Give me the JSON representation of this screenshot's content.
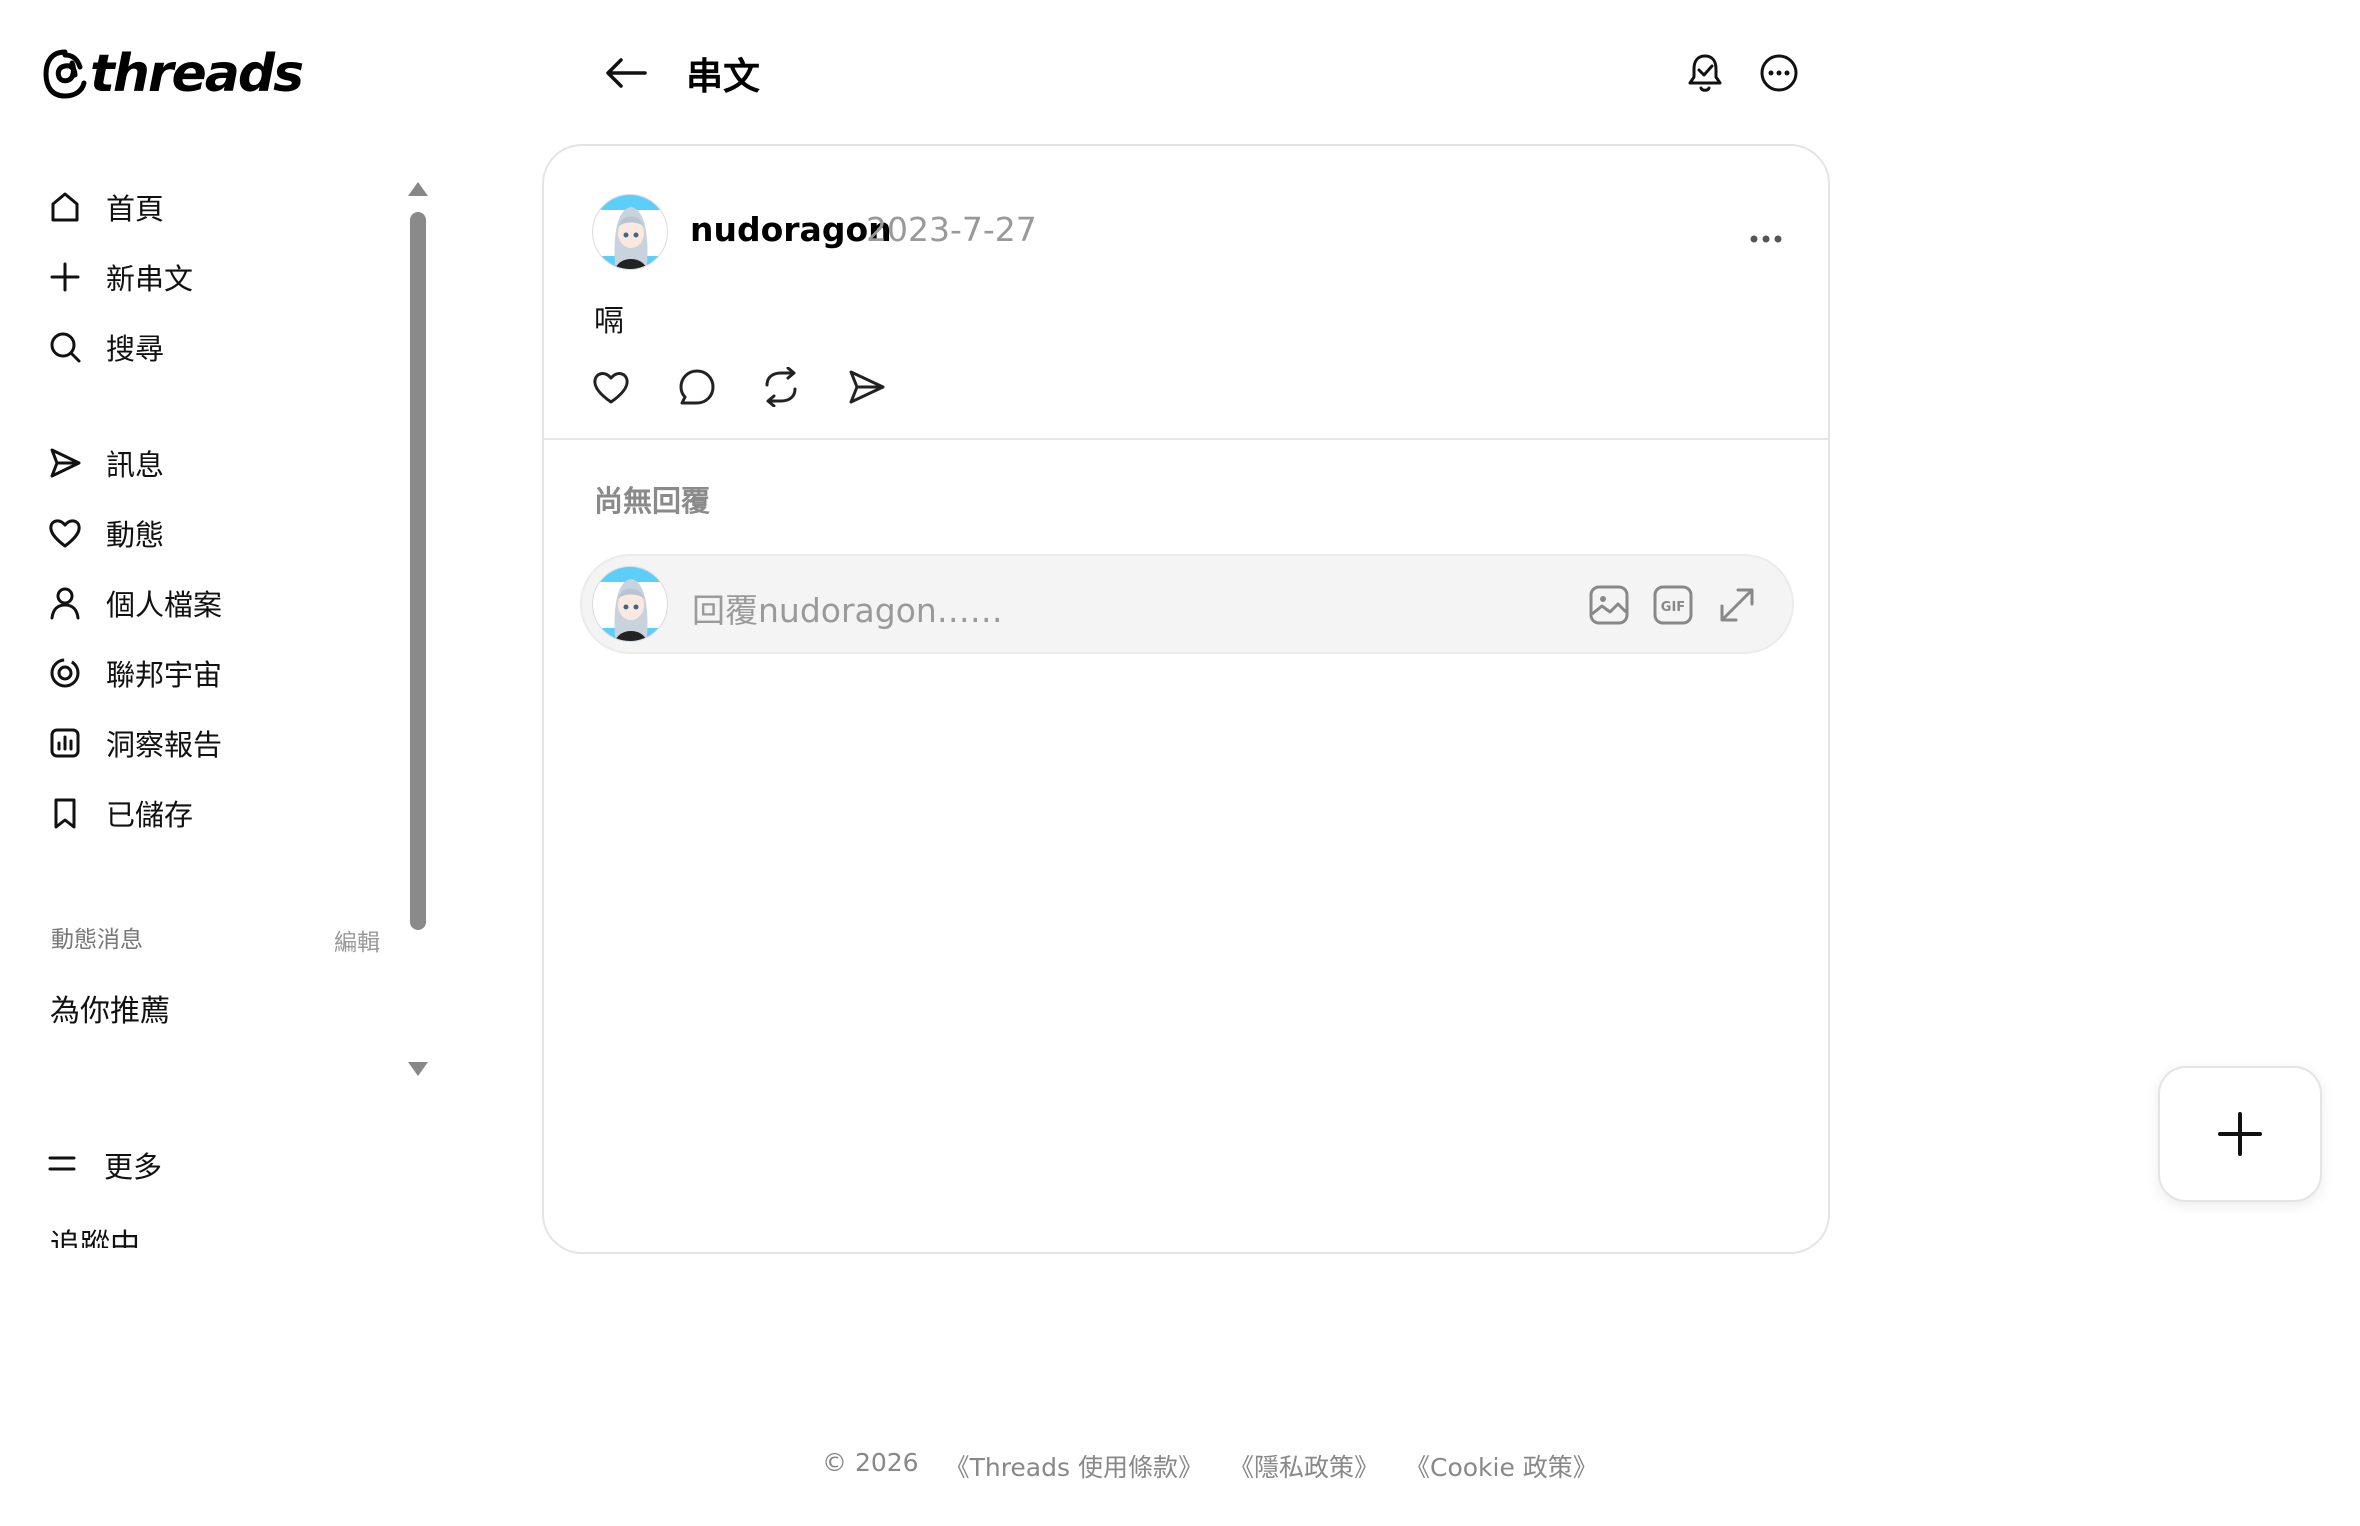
{
  "app": {
    "logo_text": "threads"
  },
  "sidebar": {
    "items": [
      {
        "label": "首頁",
        "icon": "home-icon"
      },
      {
        "label": "新串文",
        "icon": "plus-icon"
      },
      {
        "label": "搜尋",
        "icon": "search-icon"
      },
      {
        "label": "訊息",
        "icon": "send-icon"
      },
      {
        "label": "動態",
        "icon": "heart-icon"
      },
      {
        "label": "個人檔案",
        "icon": "person-icon"
      },
      {
        "label": "聯邦宇宙",
        "icon": "fediverse-icon"
      },
      {
        "label": "洞察報告",
        "icon": "chart-icon"
      },
      {
        "label": "已儲存",
        "icon": "bookmark-icon"
      }
    ],
    "feeds_title": "動態消息",
    "feeds_edit": "編輯",
    "feeds": [
      {
        "label": "為你推薦"
      },
      {
        "label": "追蹤中"
      }
    ],
    "more_label": "更多",
    "more_icon": "menu-icon"
  },
  "header": {
    "title": "串文",
    "back_icon": "arrow-left-icon",
    "notify_icon": "bell-check-icon",
    "more_icon": "more-circle-icon"
  },
  "post": {
    "author": "nudoragon",
    "date": "2023-7-27",
    "text": "嗝",
    "menu_icon": "ellipsis-icon",
    "actions": [
      "heart-icon",
      "comment-icon",
      "repost-icon",
      "share-icon"
    ]
  },
  "replies": {
    "empty_text": "尚無回覆",
    "placeholder": "回覆nudoragon……",
    "gif_label": "GIF",
    "icons": [
      "image-icon",
      "gif-icon",
      "expand-icon"
    ]
  },
  "footer": {
    "copyright": "© 2026",
    "terms": "《Threads 使用條款》",
    "privacy": "《隱私政策》",
    "cookie": "《Cookie 政策》"
  },
  "fab": {
    "icon": "plus-icon"
  },
  "colors": {
    "text": "#111111",
    "muted": "#999999",
    "border": "#e4e4e4",
    "reply_bg": "#f4f4f4"
  }
}
